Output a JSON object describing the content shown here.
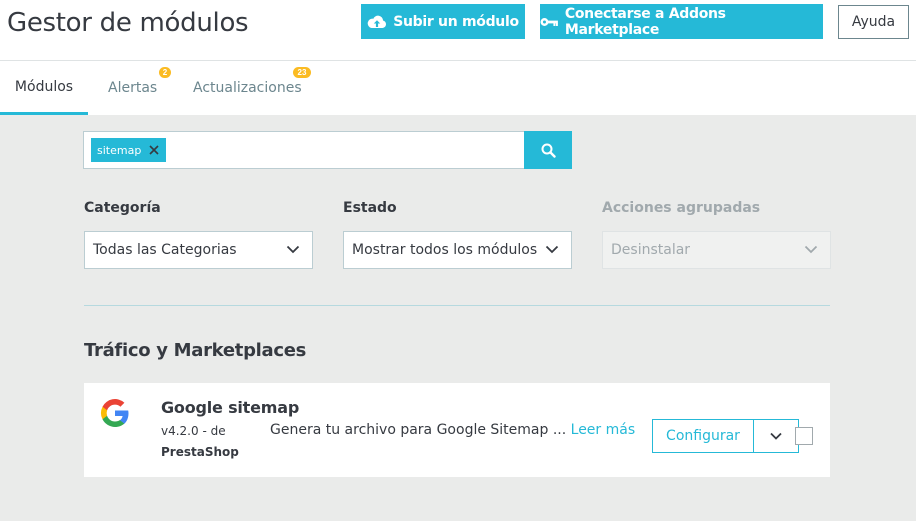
{
  "header": {
    "title": "Gestor de módulos",
    "upload_label": "Subir un módulo",
    "connect_label": "Conectarse a Addons Marketplace",
    "help_label": "Ayuda"
  },
  "tabs": [
    {
      "label": "Módulos"
    },
    {
      "label": "Alertas",
      "badge": "2"
    },
    {
      "label": "Actualizaciones",
      "badge": "23"
    }
  ],
  "search": {
    "tag": "sitemap"
  },
  "filters": {
    "category_label": "Categoría",
    "category_value": "Todas las Categorias",
    "status_label": "Estado",
    "status_value": "Mostrar todos los módulos",
    "bulk_label": "Acciones agrupadas",
    "bulk_value": "Desinstalar"
  },
  "section": {
    "title": "Tráfico y Marketplaces"
  },
  "module": {
    "name": "Google sitemap",
    "version": "v4.2.0 - de",
    "author": "PrestaShop",
    "description": "Genera tu archivo para Google Sitemap ...",
    "read_more": "Leer más",
    "configure_label": "Configurar"
  },
  "colors": {
    "accent": "#25b9d7",
    "badge": "#fbbb22",
    "background": "#eaebea",
    "text": "#363a41"
  }
}
